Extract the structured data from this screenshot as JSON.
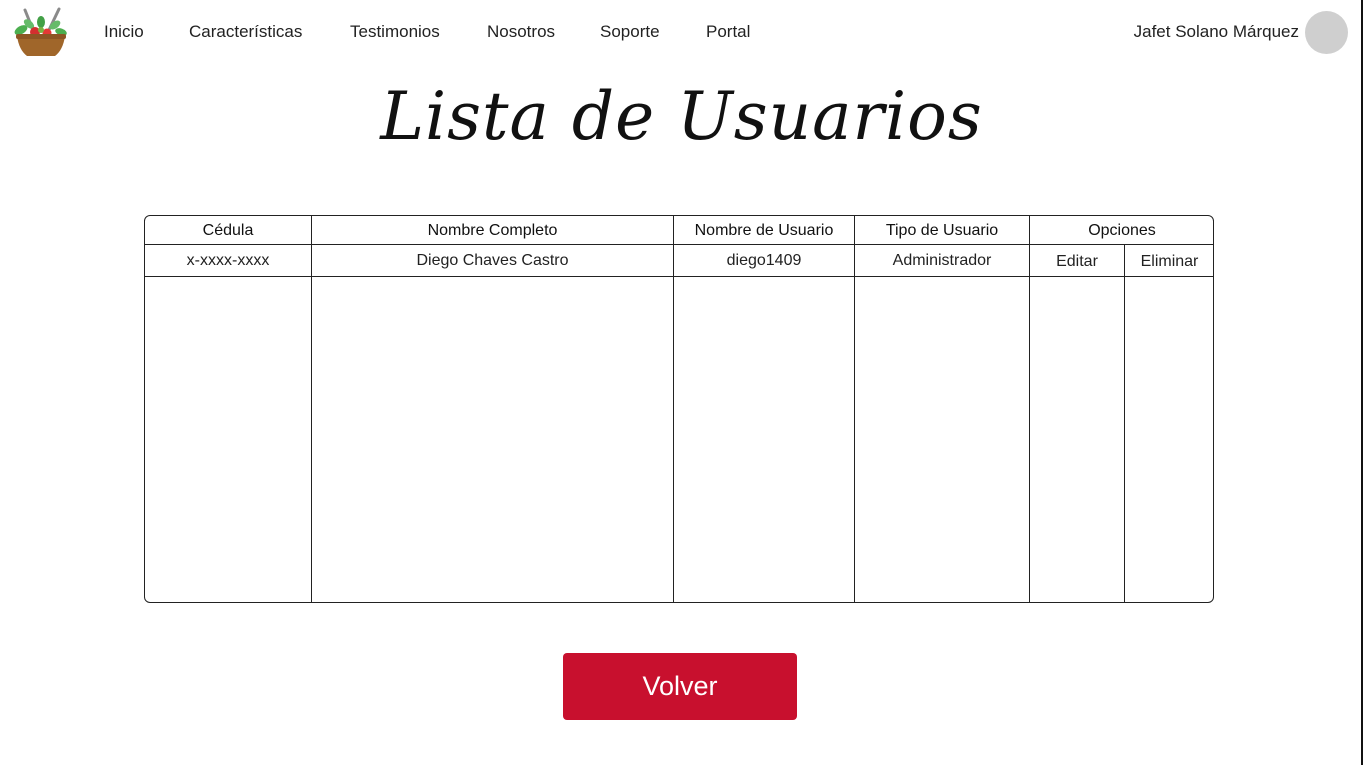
{
  "nav": {
    "items": [
      {
        "label": "Inicio"
      },
      {
        "label": "Características"
      },
      {
        "label": "Testimonios"
      },
      {
        "label": "Nosotros"
      },
      {
        "label": "Soporte"
      },
      {
        "label": "Portal"
      }
    ],
    "user_name": "Jafet Solano Márquez"
  },
  "page": {
    "title": "Lista de Usuarios"
  },
  "table": {
    "headers": [
      "Cédula",
      "Nombre Completo",
      "Nombre de Usuario",
      "Tipo de Usuario",
      "Opciones"
    ],
    "rows": [
      {
        "cedula": "x-xxxx-xxxx",
        "nombre_completo": "Diego Chaves Castro",
        "nombre_usuario": "diego1409",
        "tipo_usuario": "Administrador",
        "editar_label": "Editar",
        "eliminar_label": "Eliminar"
      }
    ]
  },
  "actions": {
    "back_label": "Volver"
  },
  "colors": {
    "accent": "#c8102e",
    "avatar": "#cfcfcf",
    "basket": "#a0662a",
    "leaf": "#4caf50",
    "tomato": "#d32f2f"
  },
  "icons": {
    "logo": "salad-basket-icon",
    "avatar": "user-avatar"
  }
}
